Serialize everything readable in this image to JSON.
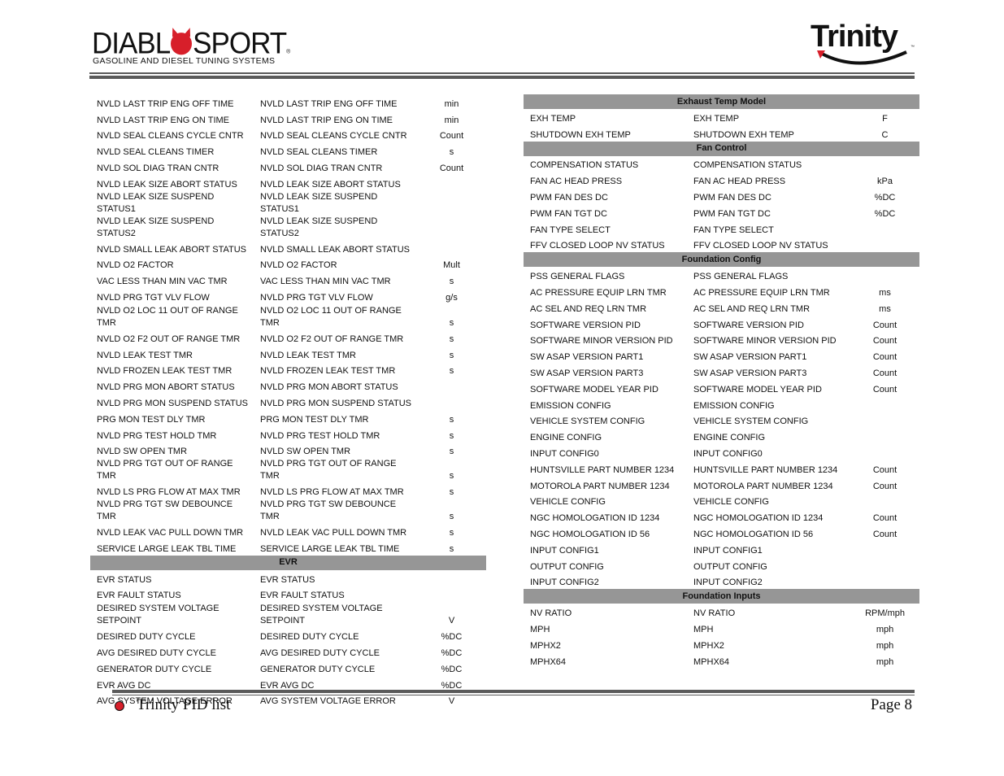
{
  "header": {
    "left_logo": {
      "wordmark_pre": "DIABL",
      "wordmark_post": "SPORT",
      "registered": "®",
      "tagline": "GASOLINE AND DIESEL TUNING SYSTEMS",
      "icon": "devil-head-icon"
    },
    "right_logo": {
      "wordmark": "Trinity",
      "trademark": "™",
      "icon": "swoosh-icon"
    }
  },
  "colors": {
    "section_header_bg": "#969696",
    "rule": "#5a5a5a",
    "brand_red": "#d71f2a"
  },
  "left_table": {
    "rows": [
      {
        "name": "NVLD LAST TRIP ENG OFF TIME",
        "desc": "NVLD LAST TRIP ENG OFF TIME",
        "unit": "min"
      },
      {
        "name": "NVLD LAST TRIP ENG ON TIME",
        "desc": "NVLD LAST TRIP ENG ON TIME",
        "unit": "min"
      },
      {
        "name": "NVLD SEAL CLEANS CYCLE CNTR",
        "desc": "NVLD SEAL CLEANS CYCLE CNTR",
        "unit": "Count"
      },
      {
        "name": "NVLD SEAL CLEANS TIMER",
        "desc": "NVLD SEAL CLEANS TIMER",
        "unit": "s"
      },
      {
        "name": "NVLD SOL DIAG TRAN CNTR",
        "desc": "NVLD SOL DIAG TRAN CNTR",
        "unit": "Count"
      },
      {
        "name": "NVLD LEAK SIZE ABORT STATUS",
        "desc": "NVLD LEAK SIZE ABORT STATUS",
        "unit": ""
      },
      {
        "name": "NVLD LEAK SIZE SUSPEND STATUS1",
        "desc": "NVLD LEAK SIZE SUSPEND STATUS1",
        "unit": ""
      },
      {
        "name": "NVLD LEAK SIZE SUSPEND STATUS2",
        "desc": "NVLD LEAK SIZE SUSPEND STATUS2",
        "unit": ""
      },
      {
        "name": "NVLD SMALL LEAK ABORT STATUS",
        "desc": "NVLD SMALL LEAK ABORT STATUS",
        "unit": ""
      },
      {
        "name": "NVLD O2 FACTOR",
        "desc": "NVLD O2 FACTOR",
        "unit": "Mult"
      },
      {
        "name": "VAC LESS THAN MIN VAC TMR",
        "desc": "VAC LESS THAN MIN VAC TMR",
        "unit": "s"
      },
      {
        "name": "NVLD PRG TGT VLV FLOW",
        "desc": "NVLD PRG TGT VLV FLOW",
        "unit": "g/s"
      },
      {
        "name": "NVLD O2 LOC 11 OUT OF RANGE TMR",
        "desc": "NVLD O2 LOC 11 OUT OF RANGE TMR",
        "unit": "s",
        "tall": true
      },
      {
        "name": "NVLD O2 F2 OUT OF RANGE TMR",
        "desc": "NVLD O2 F2 OUT OF RANGE TMR",
        "unit": "s"
      },
      {
        "name": "NVLD LEAK TEST TMR",
        "desc": "NVLD LEAK TEST TMR",
        "unit": "s"
      },
      {
        "name": "NVLD FROZEN LEAK TEST TMR",
        "desc": "NVLD FROZEN LEAK TEST TMR",
        "unit": "s"
      },
      {
        "name": "NVLD PRG MON ABORT STATUS",
        "desc": "NVLD PRG MON ABORT STATUS",
        "unit": ""
      },
      {
        "name": "NVLD PRG MON SUSPEND STATUS",
        "desc": "NVLD PRG MON SUSPEND STATUS",
        "unit": ""
      },
      {
        "name": "PRG MON TEST DLY TMR",
        "desc": "PRG MON TEST DLY TMR",
        "unit": "s"
      },
      {
        "name": "NVLD PRG TEST HOLD TMR",
        "desc": "NVLD PRG TEST HOLD TMR",
        "unit": "s"
      },
      {
        "name": "NVLD SW OPEN TMR",
        "desc": "NVLD SW OPEN TMR",
        "unit": "s"
      },
      {
        "name": "NVLD PRG TGT OUT OF RANGE TMR",
        "desc": "NVLD PRG TGT OUT OF RANGE TMR",
        "unit": "s"
      },
      {
        "name": "NVLD LS PRG FLOW AT MAX TMR",
        "desc": "NVLD LS PRG FLOW AT MAX TMR",
        "unit": "s"
      },
      {
        "name": "NVLD PRG TGT SW DEBOUNCE TMR",
        "desc": "NVLD PRG TGT SW DEBOUNCE TMR",
        "unit": "s"
      },
      {
        "name": "NVLD LEAK VAC PULL DOWN TMR",
        "desc": "NVLD LEAK VAC PULL DOWN TMR",
        "unit": "s"
      },
      {
        "name": "SERVICE LARGE LEAK TBL TIME",
        "desc": "SERVICE LARGE LEAK TBL TIME",
        "unit": "s"
      },
      {
        "section": "EVR"
      },
      {
        "name": "EVR STATUS",
        "desc": "EVR STATUS",
        "unit": ""
      },
      {
        "name": "EVR FAULT STATUS",
        "desc": "EVR FAULT STATUS",
        "unit": ""
      },
      {
        "name": "DESIRED SYSTEM VOLTAGE SETPOINT",
        "desc": "DESIRED SYSTEM VOLTAGE SETPOINT",
        "unit": "V",
        "tall": true
      },
      {
        "name": "DESIRED DUTY CYCLE",
        "desc": "DESIRED DUTY CYCLE",
        "unit": "%DC"
      },
      {
        "name": "AVG DESIRED DUTY CYCLE",
        "desc": "AVG DESIRED DUTY CYCLE",
        "unit": "%DC"
      },
      {
        "name": "GENERATOR DUTY CYCLE",
        "desc": "GENERATOR DUTY CYCLE",
        "unit": "%DC"
      },
      {
        "name": "EVR AVG DC",
        "desc": "EVR AVG DC",
        "unit": "%DC"
      },
      {
        "name": "AVG SYSTEM VOLTAGE ERROR",
        "desc": "AVG SYSTEM VOLTAGE ERROR",
        "unit": "V"
      }
    ]
  },
  "right_table": {
    "rows": [
      {
        "section": "Exhaust Temp Model"
      },
      {
        "name": "EXH TEMP",
        "desc": "EXH TEMP",
        "unit": "F"
      },
      {
        "name": "SHUTDOWN EXH TEMP",
        "desc": "SHUTDOWN EXH TEMP",
        "unit": "C"
      },
      {
        "section": "Fan Control"
      },
      {
        "name": "COMPENSATION STATUS",
        "desc": "COMPENSATION STATUS",
        "unit": ""
      },
      {
        "name": "FAN AC HEAD PRESS",
        "desc": "FAN AC HEAD PRESS",
        "unit": "kPa"
      },
      {
        "name": "PWM FAN DES DC",
        "desc": "PWM FAN DES DC",
        "unit": "%DC"
      },
      {
        "name": "PWM FAN TGT DC",
        "desc": "PWM FAN TGT DC",
        "unit": "%DC"
      },
      {
        "name": "FAN TYPE SELECT",
        "desc": "FAN TYPE SELECT",
        "unit": ""
      },
      {
        "name": "FFV CLOSED LOOP NV STATUS",
        "desc": "FFV CLOSED LOOP NV STATUS",
        "unit": ""
      },
      {
        "section": "Foundation Config"
      },
      {
        "name": "PSS GENERAL FLAGS",
        "desc": "PSS GENERAL FLAGS",
        "unit": ""
      },
      {
        "name": "AC PRESSURE EQUIP LRN TMR",
        "desc": "AC PRESSURE EQUIP LRN TMR",
        "unit": "ms"
      },
      {
        "name": "AC SEL AND REQ LRN TMR",
        "desc": "AC SEL AND REQ LRN TMR",
        "unit": "ms"
      },
      {
        "name": "SOFTWARE VERSION PID",
        "desc": "SOFTWARE VERSION PID",
        "unit": "Count"
      },
      {
        "name": "SOFTWARE MINOR VERSION PID",
        "desc": "SOFTWARE MINOR VERSION PID",
        "unit": "Count"
      },
      {
        "name": "SW ASAP VERSION PART1",
        "desc": "SW ASAP VERSION PART1",
        "unit": "Count"
      },
      {
        "name": "SW ASAP VERSION PART3",
        "desc": "SW ASAP VERSION PART3",
        "unit": "Count"
      },
      {
        "name": "SOFTWARE MODEL YEAR PID",
        "desc": "SOFTWARE MODEL YEAR PID",
        "unit": "Count"
      },
      {
        "name": "EMISSION CONFIG",
        "desc": "EMISSION CONFIG",
        "unit": ""
      },
      {
        "name": "VEHICLE SYSTEM CONFIG",
        "desc": "VEHICLE SYSTEM CONFIG",
        "unit": ""
      },
      {
        "name": "ENGINE CONFIG",
        "desc": "ENGINE CONFIG",
        "unit": ""
      },
      {
        "name": "INPUT CONFIG0",
        "desc": "INPUT CONFIG0",
        "unit": ""
      },
      {
        "name": "HUNTSVILLE PART NUMBER 1234",
        "desc": "HUNTSVILLE PART NUMBER 1234",
        "unit": "Count"
      },
      {
        "name": "MOTOROLA PART NUMBER 1234",
        "desc": "MOTOROLA PART NUMBER 1234",
        "unit": "Count"
      },
      {
        "name": "VEHICLE CONFIG",
        "desc": "VEHICLE CONFIG",
        "unit": ""
      },
      {
        "name": "NGC HOMOLOGATION ID 1234",
        "desc": "NGC HOMOLOGATION ID 1234",
        "unit": "Count"
      },
      {
        "name": "NGC HOMOLOGATION ID 56",
        "desc": "NGC HOMOLOGATION ID 56",
        "unit": "Count"
      },
      {
        "name": "INPUT CONFIG1",
        "desc": "INPUT CONFIG1",
        "unit": ""
      },
      {
        "name": "OUTPUT CONFIG",
        "desc": "OUTPUT CONFIG",
        "unit": ""
      },
      {
        "name": "INPUT CONFIG2",
        "desc": "INPUT CONFIG2",
        "unit": ""
      },
      {
        "section": "Foundation Inputs"
      },
      {
        "name": "NV RATIO",
        "desc": "NV RATIO",
        "unit": "RPM/mph"
      },
      {
        "name": "MPH",
        "desc": "MPH",
        "unit": "mph"
      },
      {
        "name": "MPHX2",
        "desc": "MPHX2",
        "unit": "mph"
      },
      {
        "name": "MPHX64",
        "desc": "MPHX64",
        "unit": "mph"
      }
    ]
  },
  "footer": {
    "title": "Trinity PID list",
    "page": "Page 8",
    "icon": "devil-head-icon"
  }
}
